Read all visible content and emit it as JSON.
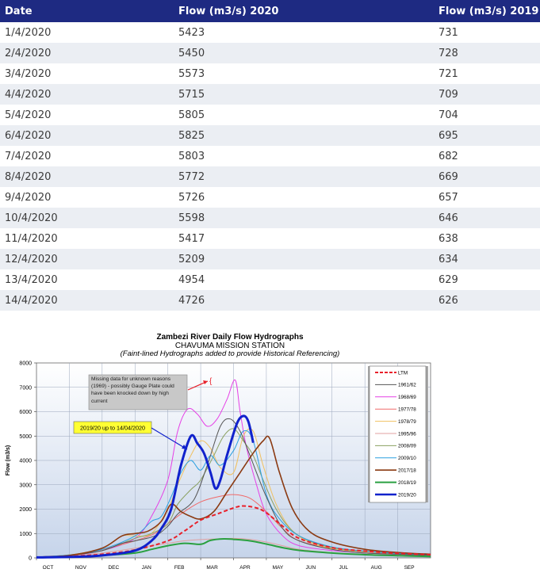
{
  "table": {
    "headers": [
      "Date",
      "Flow (m3/s) 2020",
      "Flow (m3/s) 2019"
    ],
    "rows": [
      [
        "1/4/2020",
        "5423",
        "731"
      ],
      [
        "2/4/2020",
        "5450",
        "728"
      ],
      [
        "3/4/2020",
        "5573",
        "721"
      ],
      [
        "4/4/2020",
        "5715",
        "709"
      ],
      [
        "5/4/2020",
        "5805",
        "704"
      ],
      [
        "6/4/2020",
        "5825",
        "695"
      ],
      [
        "7/4/2020",
        "5803",
        "682"
      ],
      [
        "8/4/2020",
        "5772",
        "669"
      ],
      [
        "9/4/2020",
        "5726",
        "657"
      ],
      [
        "10/4/2020",
        "5598",
        "646"
      ],
      [
        "11/4/2020",
        "5417",
        "638"
      ],
      [
        "12/4/2020",
        "5209",
        "634"
      ],
      [
        "13/4/2020",
        "4954",
        "629"
      ],
      [
        "14/4/2020",
        "4726",
        "626"
      ]
    ]
  },
  "chart_data": {
    "type": "line",
    "title": "Zambezi River Daily Flow Hydrographs",
    "subtitle": "CHAVUMA MISSION STATION",
    "note": "(Faint-lined Hydrographs added to provide Historical Referencing)",
    "ylabel": "Flow (m3/s)",
    "xlabel": "",
    "ylim": [
      0,
      8000
    ],
    "yticks": [
      "0",
      "1000",
      "2000",
      "3000",
      "4000",
      "5000",
      "6000",
      "7000",
      "8000"
    ],
    "xticks": [
      "OCT",
      "NOV",
      "DEC",
      "JAN",
      "FEB",
      "MAR",
      "APR",
      "MAY",
      "JUN",
      "JUL",
      "AUG",
      "SEP"
    ],
    "grid": true,
    "legend_position": "right",
    "annotations": {
      "missing_data": "Missing data for unknown reasons (1969) - possibly Gauge Plate could have been knocked down by high current",
      "current": "2019/20 up to 14/04/2020"
    },
    "series": [
      {
        "name": "LTM",
        "color": "#e8202a",
        "dash": true,
        "width": 2,
        "points": [
          [
            0,
            30
          ],
          [
            1,
            60
          ],
          [
            2,
            150
          ],
          [
            3,
            330
          ],
          [
            4,
            700
          ],
          [
            4.5,
            1100
          ],
          [
            5,
            1550
          ],
          [
            5.5,
            1800
          ],
          [
            6,
            2050
          ],
          [
            6.3,
            2130
          ],
          [
            6.7,
            2050
          ],
          [
            7,
            1850
          ],
          [
            7.5,
            1300
          ],
          [
            8,
            800
          ],
          [
            9,
            420
          ],
          [
            10,
            280
          ],
          [
            11,
            190
          ],
          [
            12,
            130
          ]
        ]
      },
      {
        "name": "1961/62",
        "color": "#555555",
        "width": 1,
        "points": [
          [
            0,
            40
          ],
          [
            1,
            100
          ],
          [
            2,
            300
          ],
          [
            2.6,
            600
          ],
          [
            3,
            700
          ],
          [
            3.6,
            900
          ],
          [
            4,
            1300
          ],
          [
            4.3,
            1800
          ],
          [
            4.8,
            2400
          ],
          [
            5.2,
            3800
          ],
          [
            5.6,
            5400
          ],
          [
            5.9,
            5700
          ],
          [
            6.2,
            5200
          ],
          [
            6.5,
            4200
          ],
          [
            7,
            2500
          ],
          [
            7.5,
            1200
          ],
          [
            8,
            700
          ],
          [
            9,
            350
          ],
          [
            10,
            200
          ],
          [
            11,
            150
          ],
          [
            12,
            100
          ]
        ]
      },
      {
        "name": "1968/69",
        "color": "#e640e6",
        "width": 1,
        "points": [
          [
            0,
            40
          ],
          [
            1,
            100
          ],
          [
            2,
            300
          ],
          [
            3,
            800
          ],
          [
            3.5,
            1700
          ],
          [
            4,
            3200
          ],
          [
            4.3,
            5200
          ],
          [
            4.6,
            6100
          ],
          [
            4.9,
            5900
          ],
          [
            5.2,
            5400
          ],
          [
            5.5,
            5700
          ],
          [
            5.8,
            6500
          ],
          [
            6.05,
            7300
          ],
          [
            6.2,
            6000
          ],
          [
            6.4,
            4500
          ],
          [
            6.7,
            3000
          ],
          [
            7,
            1800
          ],
          [
            7.5,
            900
          ],
          [
            8,
            500
          ],
          [
            9,
            300
          ],
          [
            10,
            200
          ],
          [
            11,
            150
          ],
          [
            12,
            100
          ]
        ]
      },
      {
        "name": "1977/78",
        "color": "#f06a6a",
        "width": 1,
        "points": [
          [
            0,
            40
          ],
          [
            1,
            120
          ],
          [
            2,
            350
          ],
          [
            3,
            700
          ],
          [
            3.6,
            1000
          ],
          [
            4,
            1400
          ],
          [
            4.5,
            1900
          ],
          [
            5,
            2300
          ],
          [
            5.5,
            2500
          ],
          [
            6,
            2600
          ],
          [
            6.5,
            2450
          ],
          [
            7,
            1900
          ],
          [
            7.5,
            1200
          ],
          [
            8,
            700
          ],
          [
            9,
            400
          ],
          [
            10,
            250
          ],
          [
            11,
            180
          ],
          [
            12,
            120
          ]
        ]
      },
      {
        "name": "1978/79",
        "color": "#f0c060",
        "width": 1,
        "points": [
          [
            0,
            40
          ],
          [
            1,
            120
          ],
          [
            2,
            400
          ],
          [
            2.6,
            900
          ],
          [
            3,
            900
          ],
          [
            3.5,
            1000
          ],
          [
            4,
            2000
          ],
          [
            4.3,
            3000
          ],
          [
            4.7,
            4200
          ],
          [
            5,
            4800
          ],
          [
            5.3,
            4500
          ],
          [
            5.6,
            3700
          ],
          [
            6,
            3500
          ],
          [
            6.3,
            5000
          ],
          [
            6.6,
            5200
          ],
          [
            6.9,
            3800
          ],
          [
            7.3,
            2200
          ],
          [
            7.8,
            1100
          ],
          [
            8.5,
            550
          ],
          [
            9.5,
            300
          ],
          [
            11,
            170
          ],
          [
            12,
            110
          ]
        ]
      },
      {
        "name": "1995/96",
        "color": "#e0a0a0",
        "width": 1,
        "points": [
          [
            0,
            30
          ],
          [
            1,
            80
          ],
          [
            2,
            200
          ],
          [
            3,
            400
          ],
          [
            4,
            600
          ],
          [
            4.5,
            700
          ],
          [
            5,
            750
          ],
          [
            5.5,
            780
          ],
          [
            6,
            800
          ],
          [
            6.5,
            760
          ],
          [
            7,
            650
          ],
          [
            7.5,
            500
          ],
          [
            8,
            350
          ],
          [
            9,
            220
          ],
          [
            10,
            150
          ],
          [
            11,
            110
          ],
          [
            12,
            80
          ]
        ]
      },
      {
        "name": "2008/09",
        "color": "#8aa060",
        "width": 1,
        "points": [
          [
            0,
            40
          ],
          [
            1,
            110
          ],
          [
            2,
            300
          ],
          [
            3,
            800
          ],
          [
            3.5,
            1000
          ],
          [
            4,
            1400
          ],
          [
            4.3,
            2200
          ],
          [
            4.7,
            2800
          ],
          [
            5,
            3200
          ],
          [
            5.4,
            4200
          ],
          [
            5.7,
            5000
          ],
          [
            6,
            5300
          ],
          [
            6.3,
            4800
          ],
          [
            6.6,
            4200
          ],
          [
            6.9,
            3200
          ],
          [
            7.3,
            2000
          ],
          [
            7.8,
            1100
          ],
          [
            8.5,
            600
          ],
          [
            9.5,
            320
          ],
          [
            11,
            180
          ],
          [
            12,
            120
          ]
        ]
      },
      {
        "name": "2009/10",
        "color": "#2aa0e0",
        "width": 1,
        "points": [
          [
            0,
            40
          ],
          [
            1,
            120
          ],
          [
            2,
            350
          ],
          [
            3,
            900
          ],
          [
            3.5,
            1500
          ],
          [
            3.8,
            1700
          ],
          [
            4.1,
            2500
          ],
          [
            4.4,
            3500
          ],
          [
            4.7,
            4000
          ],
          [
            5,
            3600
          ],
          [
            5.3,
            4200
          ],
          [
            5.6,
            3800
          ],
          [
            6,
            4400
          ],
          [
            6.3,
            5200
          ],
          [
            6.6,
            4800
          ],
          [
            7,
            2600
          ],
          [
            7.4,
            1600
          ],
          [
            8,
            900
          ],
          [
            9,
            450
          ],
          [
            10,
            280
          ],
          [
            11,
            180
          ],
          [
            12,
            120
          ]
        ]
      },
      {
        "name": "2017/18",
        "color": "#8b3a12",
        "width": 1.6,
        "points": [
          [
            0,
            30
          ],
          [
            1,
            100
          ],
          [
            2,
            400
          ],
          [
            2.6,
            900
          ],
          [
            3,
            1000
          ],
          [
            3.4,
            1100
          ],
          [
            3.8,
            1500
          ],
          [
            4.1,
            2200
          ],
          [
            4.4,
            1900
          ],
          [
            4.7,
            1700
          ],
          [
            5,
            1600
          ],
          [
            5.4,
            1900
          ],
          [
            5.8,
            2700
          ],
          [
            6.2,
            3500
          ],
          [
            6.6,
            4300
          ],
          [
            6.9,
            4800
          ],
          [
            7.1,
            4900
          ],
          [
            7.4,
            3500
          ],
          [
            7.8,
            2000
          ],
          [
            8.3,
            1100
          ],
          [
            9,
            650
          ],
          [
            10,
            350
          ],
          [
            11,
            220
          ],
          [
            12,
            150
          ]
        ]
      },
      {
        "name": "2018/19",
        "color": "#2aa040",
        "width": 2,
        "points": [
          [
            0,
            20
          ],
          [
            1,
            40
          ],
          [
            2,
            100
          ],
          [
            3,
            200
          ],
          [
            3.5,
            350
          ],
          [
            4,
            500
          ],
          [
            4.5,
            600
          ],
          [
            5,
            560
          ],
          [
            5.3,
            720
          ],
          [
            5.7,
            780
          ],
          [
            6,
            760
          ],
          [
            6.5,
            700
          ],
          [
            7,
            570
          ],
          [
            7.5,
            420
          ],
          [
            8,
            310
          ],
          [
            9,
            200
          ],
          [
            10,
            130
          ],
          [
            11,
            90
          ],
          [
            12,
            60
          ]
        ]
      },
      {
        "name": "2019/20",
        "color": "#1122cc",
        "width": 3,
        "points": [
          [
            0,
            20
          ],
          [
            1,
            40
          ],
          [
            2,
            100
          ],
          [
            3,
            300
          ],
          [
            3.5,
            700
          ],
          [
            3.8,
            1200
          ],
          [
            4.1,
            2000
          ],
          [
            4.4,
            3800
          ],
          [
            4.7,
            5000
          ],
          [
            4.9,
            4700
          ],
          [
            5.1,
            4300
          ],
          [
            5.3,
            3500
          ],
          [
            5.45,
            2850
          ],
          [
            5.6,
            3200
          ],
          [
            5.8,
            4200
          ],
          [
            6.1,
            5500
          ],
          [
            6.3,
            5825
          ],
          [
            6.45,
            5600
          ],
          [
            6.6,
            4726
          ]
        ]
      }
    ]
  }
}
